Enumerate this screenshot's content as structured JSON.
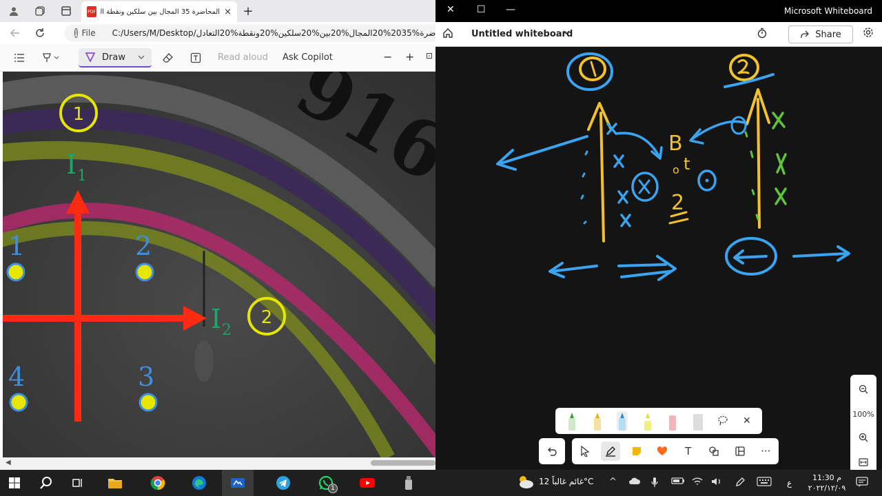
{
  "browser": {
    "tab_title": "المحاضرة 35 المجال بين سلكين ونقطة الت*",
    "tab_close": "×",
    "new_tab": "+",
    "file_label": "File",
    "url": "C:/Users/M/Desktop/المحاضرة%2035%20المجال%20بين%20سلكين%20ونقطة%20التعادل.p",
    "toolbar": {
      "draw_label": "Draw",
      "read_aloud_label": "Read aloud",
      "ask_copilot_label": "Ask Copilot",
      "zoom_out": "−",
      "zoom_in": "+"
    }
  },
  "slide": {
    "circle_1": "1",
    "circle_2": "2",
    "current_I1": "I",
    "current_I1_sub": "1",
    "current_I2": "I",
    "current_I2_sub": "2",
    "point_1": "1",
    "point_2": "2",
    "point_3": "3",
    "point_4": "4",
    "bg_text": "916"
  },
  "whiteboard": {
    "app_name": "Microsoft Whiteboard",
    "title": "Untitled whiteboard",
    "share_label": "Share",
    "zoom_level": "100%",
    "ink_text_B": "B",
    "ink_text_t": "t",
    "ink_text_o": "o",
    "ink_text_2": "2",
    "text_tool": "T",
    "more": "···"
  },
  "taskbar": {
    "weather_text": "غائم غالباً 12°C",
    "time": "11:30 م",
    "date": "٢٠٢٢/١٢/٠٩",
    "lang": "ع",
    "whatsapp_badge": "1"
  },
  "colors": {
    "red_arrow": "#ff2a12",
    "yellow_circle": "#e6e600",
    "green_label": "#21a36b",
    "blue_number": "#3f8fe0",
    "ink_blue": "#3aa4f0",
    "ink_yellow": "#f2c12e",
    "ink_green": "#5ec43a"
  }
}
